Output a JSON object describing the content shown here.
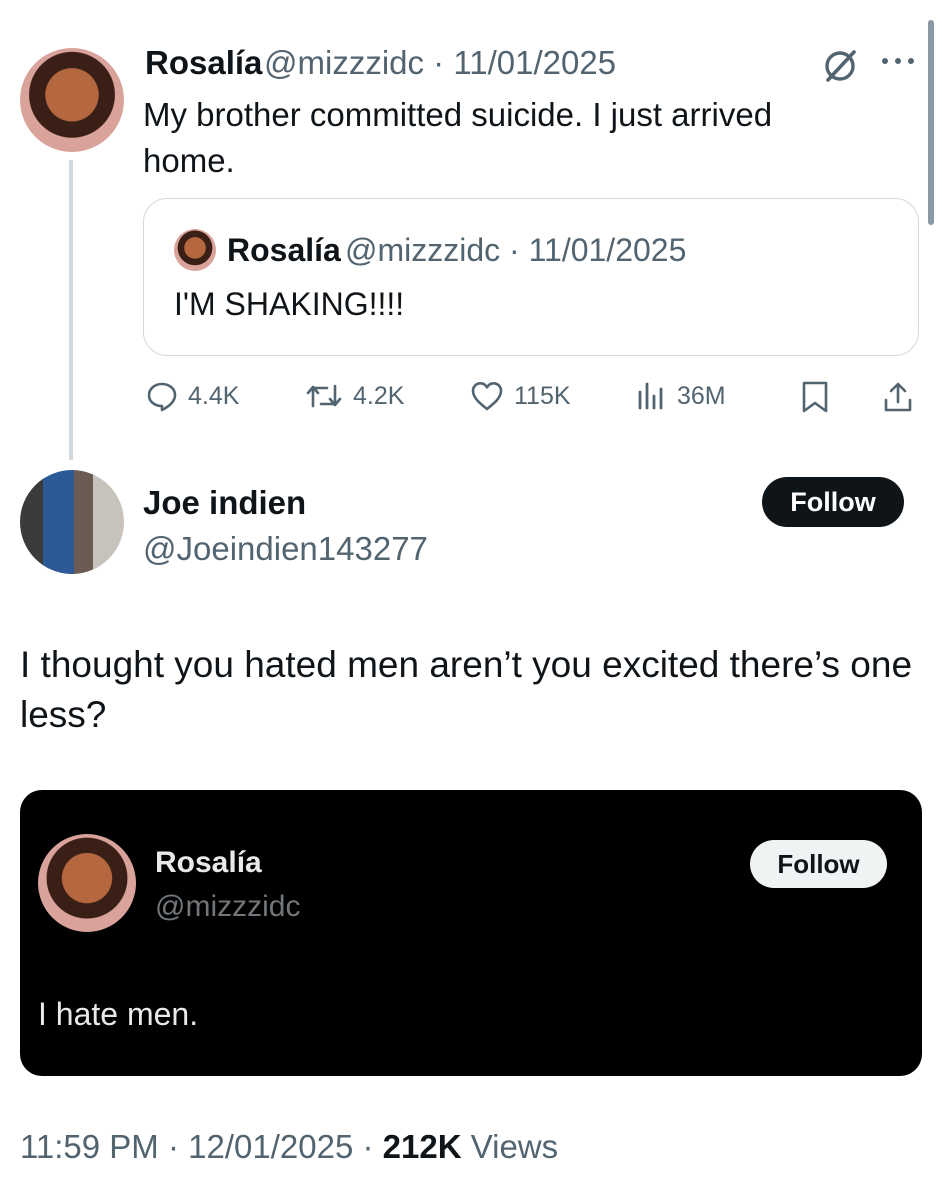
{
  "original_tweet": {
    "name": "Rosalía",
    "handle": "@mizzzidc",
    "date": "11/01/2025",
    "text": "My brother committed suicide. I just arrived home.",
    "quote": {
      "name": "Rosalía",
      "handle": "@mizzzidc",
      "date": "11/01/2025",
      "text": "I'M SHAKING!!!!"
    },
    "stats": {
      "replies": "4.4K",
      "retweets": "4.2K",
      "likes": "115K",
      "views": "36M"
    }
  },
  "reply": {
    "name": "Joe indien",
    "handle": "@Joeindien143277",
    "follow_label": "Follow",
    "text": "I thought you hated men aren’t you excited there’s one less?",
    "embed": {
      "name": "Rosalía",
      "handle": "@mizzzidc",
      "follow_label": "Follow",
      "text": "I hate men."
    },
    "time": "11:59 PM",
    "date": "12/01/2025",
    "views_count": "212K",
    "views_label": "Views"
  },
  "colors": {
    "text": "#0f1419",
    "secondary": "#536471",
    "border": "#cfd9de",
    "dark_card": "#000000"
  }
}
